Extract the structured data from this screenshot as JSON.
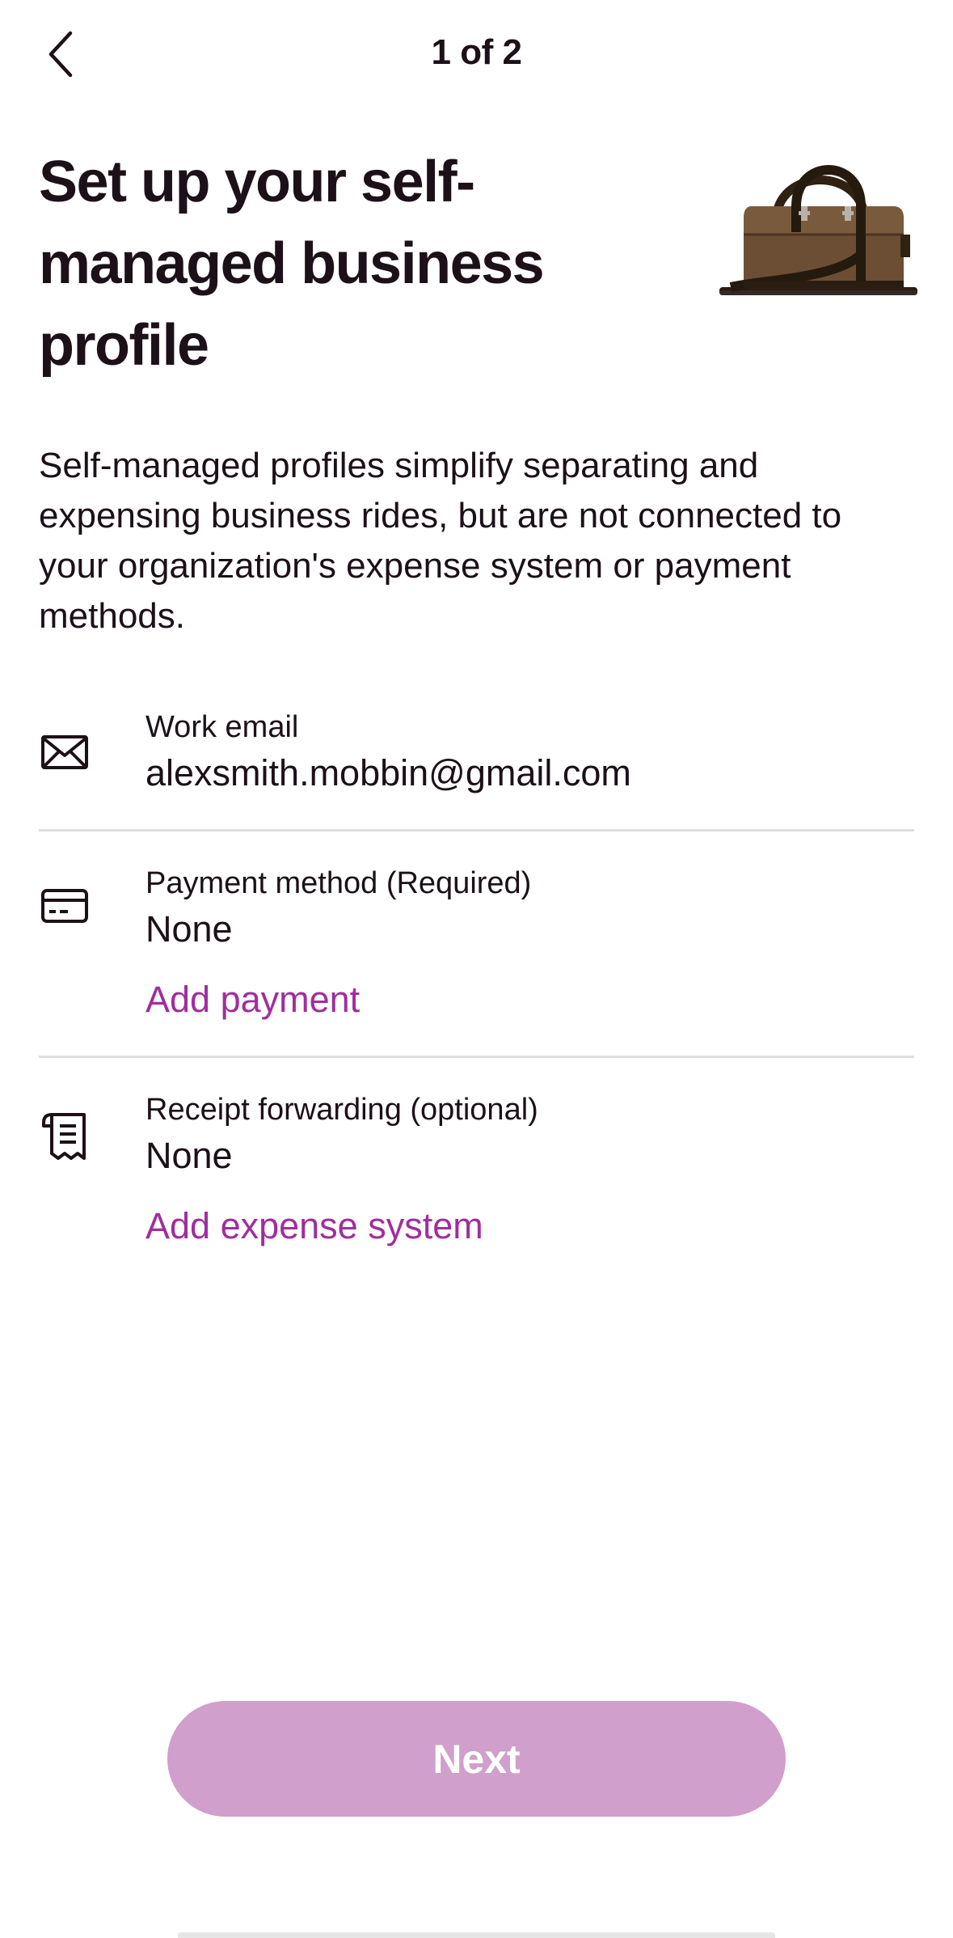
{
  "header": {
    "back_icon": "chevron-left-icon",
    "step": "1 of 2"
  },
  "hero": {
    "title": "Set up your self-managed business profile",
    "illustration": "briefcase-illustration"
  },
  "intro": "Self-managed profiles simplify separating and expensing business rides, but are not connected to your organization's expense system or payment methods.",
  "rows": {
    "email": {
      "icon": "envelope-icon",
      "label": "Work email",
      "value": "alexsmith.mobbin@gmail.com"
    },
    "payment": {
      "icon": "credit-card-icon",
      "label": "Payment method (Required)",
      "value": "None",
      "action": "Add payment"
    },
    "receipt": {
      "icon": "receipt-icon",
      "label": "Receipt forwarding (optional)",
      "value": "None",
      "action": "Add expense system"
    }
  },
  "footer": {
    "next_label": "Next",
    "next_enabled": false
  },
  "colors": {
    "text": "#1c1019",
    "accent": "#a12d9d",
    "button_disabled": "#d09fcb",
    "divider": "#dedde0"
  }
}
